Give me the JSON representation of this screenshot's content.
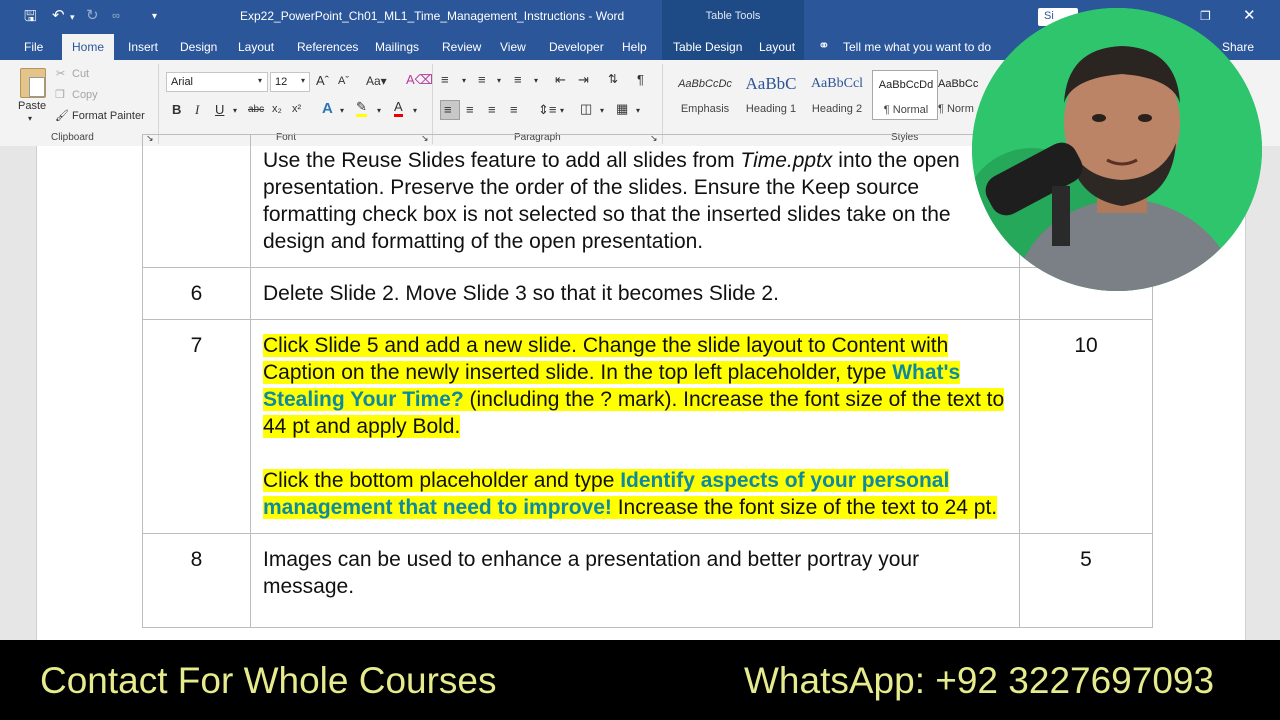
{
  "titlebar": {
    "document_title": "Exp22_PowerPoint_Ch01_ML1_Time_Management_Instructions - Word",
    "table_tools": "Table Tools",
    "sign_in": "Si"
  },
  "tabs": [
    "File",
    "Home",
    "Insert",
    "Design",
    "Layout",
    "References",
    "Mailings",
    "Review",
    "View",
    "Developer",
    "Help",
    "Table Design",
    "Layout"
  ],
  "tell_me": "Tell me what you want to do",
  "share": "Share",
  "clipboard": {
    "paste": "Paste",
    "cut": "Cut",
    "copy": "Copy",
    "format_painter": "Format Painter",
    "label": "Clipboard"
  },
  "font": {
    "name": "Arial",
    "size": "12",
    "label": "Font"
  },
  "paragraph": {
    "label": "Paragraph"
  },
  "styles": {
    "label": "Styles",
    "items": [
      {
        "preview": "AaBbCcDc",
        "name": "Emphasis"
      },
      {
        "preview": "AaBbC",
        "name": "Heading 1"
      },
      {
        "preview": "AaBbCcl",
        "name": "Heading 2"
      },
      {
        "preview": "AaBbCcDd",
        "name": "¶ Normal"
      },
      {
        "preview": "AaBbCc",
        "name": "¶ Norm"
      }
    ]
  },
  "table": {
    "row5": {
      "line_a": "Use the Reuse Slides feature to add all slides from ",
      "file": "Time.pptx",
      "line_b": " into the open presentation. Preserve the order of the slides. Ensure the Keep source formatting check box is not selected so that the inserted slides take on the design and formatting of the open presentation."
    },
    "row6": {
      "num": "6",
      "text": "Delete Slide 2. Move Slide 3 so that it becomes Slide 2.",
      "points": ""
    },
    "row7": {
      "num": "7",
      "points": "10",
      "p1_a": "Click Slide 5 and add a new slide. Change the slide layout to Content with Caption on the newly inserted slide. In the top left placeholder, type ",
      "p1_bold": "What's Stealing Your Time?",
      "p1_b": " (including the ? mark). Increase the font size of the text to 44 pt and apply Bold.",
      "p2_a": "Click the bottom placeholder and type ",
      "p2_bold": "Identify aspects of your personal management that need to improve!",
      "p2_b": " Increase the font size of the text to 24 pt."
    },
    "row8": {
      "num": "8",
      "points": "5",
      "text": "Images can be used to enhance a presentation and better portray your message."
    }
  },
  "footer": {
    "left": "Contact For Whole Courses",
    "right": "WhatsApp:  +92 3227697093"
  },
  "colors": {
    "word_blue": "#2b579a",
    "highlight": "#ffff00",
    "teal_text": "#0e8aa0",
    "footer_text": "#e6ec8e",
    "webcam_bg": "#2fc56c"
  }
}
